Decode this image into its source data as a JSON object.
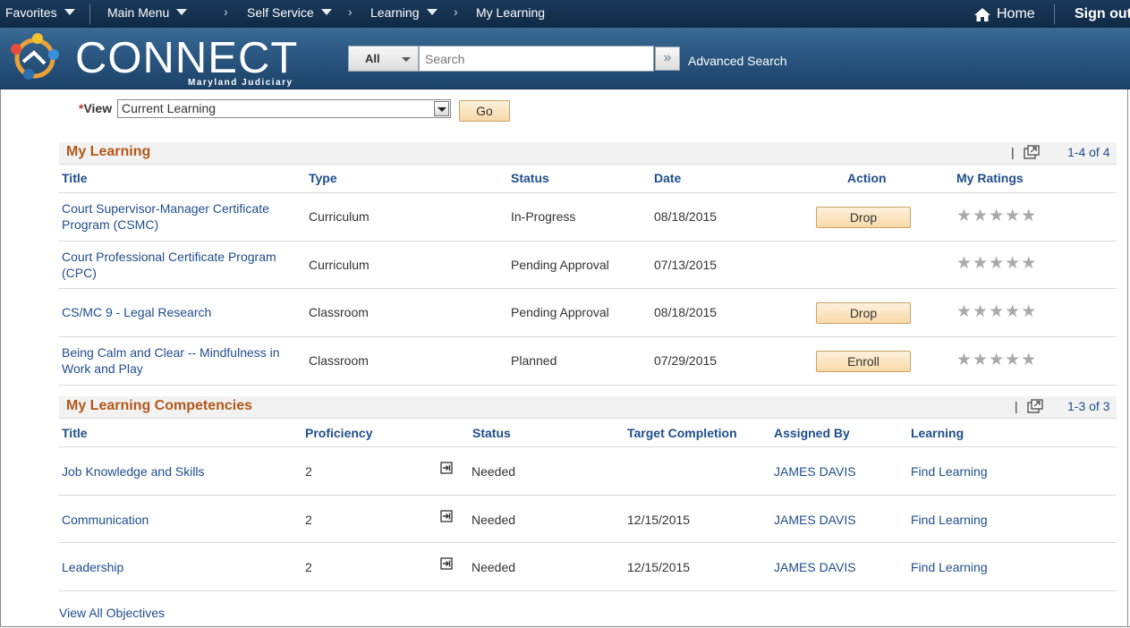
{
  "topnav": {
    "favorites": "Favorites",
    "main_menu": "Main Menu",
    "breadcrumb": [
      "Self Service",
      "Learning",
      "My Learning"
    ],
    "home": "Home",
    "signout": "Sign out"
  },
  "brand": {
    "name": "CONNECT",
    "subtitle": "Maryland Judiciary"
  },
  "search": {
    "scope": "All",
    "placeholder": "Search",
    "advanced": "Advanced Search"
  },
  "view": {
    "label": "View",
    "required_mark": "*",
    "selected": "Current Learning",
    "go": "Go"
  },
  "my_learning": {
    "title": "My Learning",
    "count": "1-4 of 4",
    "columns": [
      "Title",
      "Type",
      "Status",
      "Date",
      "Action",
      "My Ratings"
    ],
    "rows": [
      {
        "title": "Court Supervisor-Manager Certificate Program (CSMC)",
        "type": "Curriculum",
        "status": "In-Progress",
        "date": "08/18/2015",
        "action": "Drop",
        "rating": 0
      },
      {
        "title": "Court Professional Certificate Program (CPC)",
        "type": "Curriculum",
        "status": "Pending Approval",
        "date": "07/13/2015",
        "action": "",
        "rating": 0
      },
      {
        "title": "CS/MC 9 - Legal Research",
        "type": "Classroom",
        "status": "Pending Approval",
        "date": "08/18/2015",
        "action": "Drop",
        "rating": 0
      },
      {
        "title": "Being Calm and Clear -- Mindfulness in Work and Play",
        "type": "Classroom",
        "status": "Planned",
        "date": "07/29/2015",
        "action": "Enroll",
        "rating": 0
      }
    ]
  },
  "competencies": {
    "title": "My Learning Competencies",
    "count": "1-3 of 3",
    "columns": [
      "Title",
      "Proficiency",
      "Status",
      "Target Completion",
      "Assigned By",
      "Learning"
    ],
    "rows": [
      {
        "title": "Job Knowledge and Skills",
        "proficiency": "2",
        "status": "Needed",
        "target": "",
        "assigned_by": "JAMES DAVIS",
        "learning": "Find Learning"
      },
      {
        "title": "Communication",
        "proficiency": "2",
        "status": "Needed",
        "target": "12/15/2015",
        "assigned_by": "JAMES DAVIS",
        "learning": "Find Learning"
      },
      {
        "title": "Leadership",
        "proficiency": "2",
        "status": "Needed",
        "target": "12/15/2015",
        "assigned_by": "JAMES DAVIS",
        "learning": "Find Learning"
      }
    ]
  },
  "view_all": "View All Objectives",
  "icons": {
    "home": "home-icon",
    "search_go": "double-chevron-right-icon",
    "zoom": "zoom-grid-icon",
    "competency_detail": "enter-arrow-icon",
    "rating": "star-icon"
  },
  "colors": {
    "nav_bg": "#0f2a46",
    "brand_bg": "#2a5781",
    "section_title": "#b2581a",
    "link": "#1f4e8c",
    "button_bg": "#f8d9a8"
  }
}
